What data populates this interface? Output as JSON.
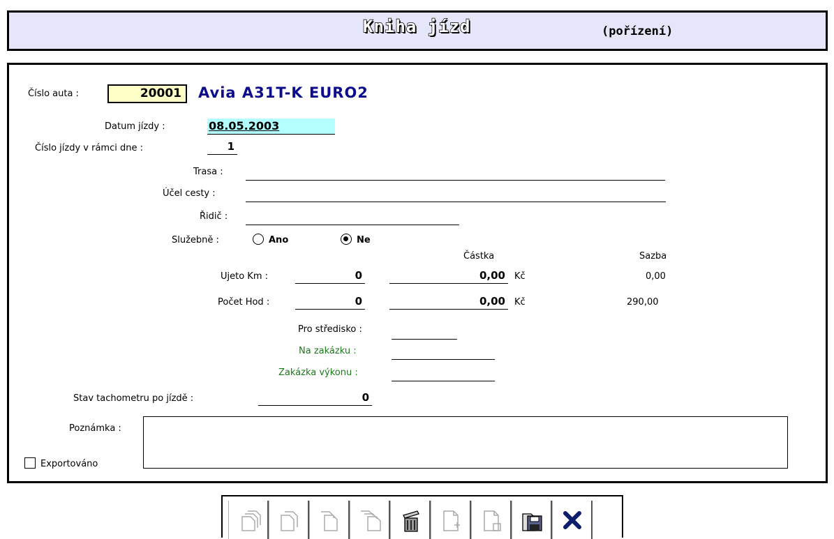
{
  "header": {
    "title": "Kniha jízd",
    "subtitle": "(pořízení)"
  },
  "form": {
    "car_number_label": "Číslo auta :",
    "car_number": "20001",
    "car_name": "Avia A31T-K EURO2",
    "date_label": "Datum jízdy :",
    "date": "08.05.2003",
    "trip_no_label": "Číslo jízdy v rámci dne :",
    "trip_no": "1",
    "route_label": "Trasa :",
    "route": "",
    "purpose_label": "Účel cesty :",
    "purpose": "",
    "driver_label": "Řidič :",
    "driver": "",
    "official_label": "Služebně :",
    "official_options": {
      "yes": "Ano",
      "no": "Ne"
    },
    "official_selected": "Ne",
    "amount_header": "Částka",
    "rate_header": "Sazba",
    "km_label": "Ujeto Km :",
    "km_value": "0",
    "km_amount": "0,00",
    "km_currency": "Kč",
    "km_rate": "0,00",
    "hours_label": "Počet Hod :",
    "hours_value": "0",
    "hours_amount": "0,00",
    "hours_currency": "Kč",
    "hours_rate": "290,00",
    "center_label": "Pro středisko :",
    "center": "",
    "order_label": "Na zakázku :",
    "order": "",
    "perf_order_label": "Zakázka výkonu :",
    "perf_order": "",
    "odometer_label": "Stav tachometru po jízdě :",
    "odometer": "0",
    "note_label": "Poznámka :",
    "note": "",
    "exported_label": "Exportováno",
    "exported": false
  },
  "colors": {
    "header_bg": "#e6e6fa",
    "car_no_bg": "#ffffc8",
    "date_bg": "#b3ffff",
    "car_name": "#0d0d8c",
    "green_label": "#1a7a1a"
  },
  "toolbar": {
    "buttons": [
      "first-record-icon",
      "previous-record-icon",
      "next-record-icon",
      "last-record-icon",
      "delete-trash-icon",
      "new-record-icon",
      "copy-record-icon",
      "save-disk-icon",
      "close-x-icon"
    ]
  }
}
